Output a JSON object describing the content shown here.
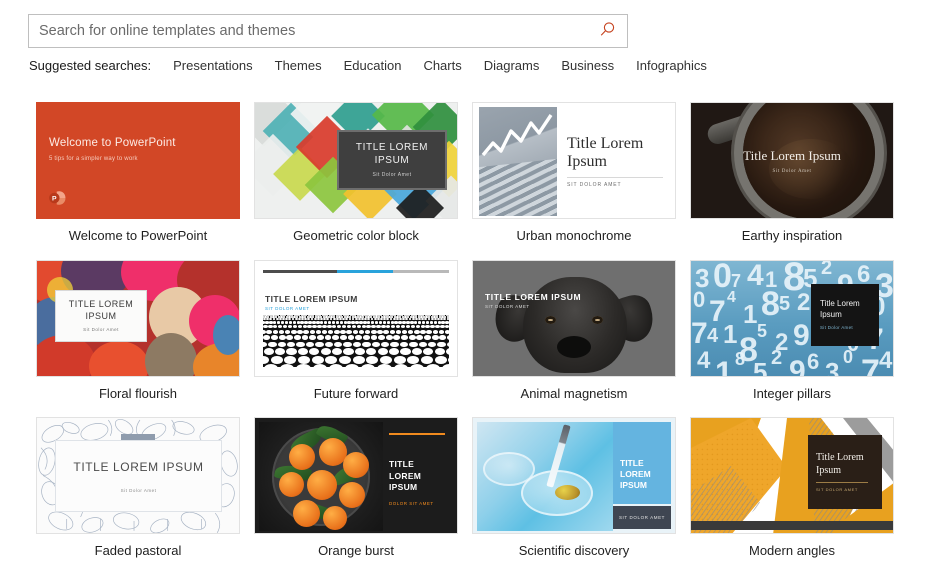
{
  "search": {
    "placeholder": "Search for online templates and themes",
    "value": "",
    "icon": "search-icon",
    "icon_color": "#c5401c"
  },
  "suggested": {
    "label": "Suggested searches:",
    "items": [
      "Presentations",
      "Themes",
      "Education",
      "Charts",
      "Diagrams",
      "Business",
      "Infographics"
    ]
  },
  "gallery": {
    "templates": [
      {
        "caption": "Welcome to PowerPoint",
        "title": "Welcome to PowerPoint",
        "subtitle": "5 tips for a simpler way to work",
        "accent": "#d24726",
        "logo": "powerpoint-logo-icon"
      },
      {
        "caption": "Geometric color block",
        "title": "TITLE LOREM IPSUM",
        "subtitle": "Sit Dolor Amet",
        "accent": "#3f3f3f"
      },
      {
        "caption": "Urban monochrome",
        "title": "Title Lorem Ipsum",
        "subtitle": "SIT DOLOR AMET",
        "accent": "#8d98a3"
      },
      {
        "caption": "Earthy inspiration",
        "title": "Title Lorem Ipsum",
        "subtitle": "Sit Dolor Amet",
        "accent": "#241c18"
      },
      {
        "caption": "Floral flourish",
        "title": "TITLE LOREM IPSUM",
        "subtitle": "Sit Dolor Amet",
        "accent": "#b4312c"
      },
      {
        "caption": "Future forward",
        "title": "TITLE LOREM IPSUM",
        "subtitle": "SIT DOLOR AMET",
        "accent": "#29a3dc"
      },
      {
        "caption": "Animal magnetism",
        "title": "TITLE LOREM IPSUM",
        "subtitle": "SIT DOLOR AMET",
        "accent": "#6f6f6f"
      },
      {
        "caption": "Integer pillars",
        "title": "Title Lorem Ipsum",
        "subtitle": "Sit Dolor Amet",
        "accent": "#5a9cc0"
      },
      {
        "caption": "Faded pastoral",
        "title": "TITLE LOREM IPSUM",
        "subtitle": "Sit Dolor Amet",
        "accent": "#8f9cad"
      },
      {
        "caption": "Orange burst",
        "title": "TITLE LOREM IPSUM",
        "subtitle": "DOLOR SIT AMET",
        "accent": "#f08a1e"
      },
      {
        "caption": "Scientific discovery",
        "title": "TITLE LOREM IPSUM",
        "subtitle": "SIT DOLOR AMET",
        "accent": "#64b4e0"
      },
      {
        "caption": "Modern angles",
        "title": "Title Lorem Ipsum",
        "subtitle": "SIT DOLOR AMET",
        "accent": "#e8a11f"
      }
    ]
  }
}
